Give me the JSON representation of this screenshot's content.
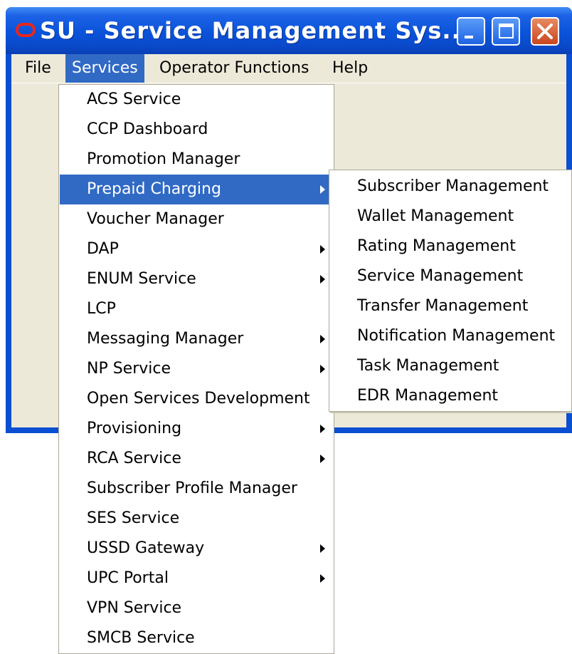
{
  "window": {
    "title": "SU - Service Management Sys...",
    "frame_color": "#0a4fd2",
    "menu_highlight_color": "#316ac5"
  },
  "menubar": [
    {
      "label": "File",
      "active": false
    },
    {
      "label": "Services",
      "active": true
    },
    {
      "label": "Operator Functions",
      "active": false
    },
    {
      "label": "Help",
      "active": false
    }
  ],
  "services_menu": {
    "items": [
      {
        "label": "ACS Service",
        "submenu": false
      },
      {
        "label": "CCP Dashboard",
        "submenu": false
      },
      {
        "label": "Promotion Manager",
        "submenu": false
      },
      {
        "label": "Prepaid Charging",
        "submenu": true,
        "highlighted": true
      },
      {
        "label": "Voucher Manager",
        "submenu": false
      },
      {
        "label": "DAP",
        "submenu": true
      },
      {
        "label": "ENUM Service",
        "submenu": true
      },
      {
        "label": "LCP",
        "submenu": false
      },
      {
        "label": "Messaging Manager",
        "submenu": true
      },
      {
        "label": "NP Service",
        "submenu": true
      },
      {
        "label": "Open Services Development",
        "submenu": false
      },
      {
        "label": "Provisioning",
        "submenu": true
      },
      {
        "label": "RCA Service",
        "submenu": true
      },
      {
        "label": "Subscriber Profile Manager",
        "submenu": false
      },
      {
        "label": "SES Service",
        "submenu": false
      },
      {
        "label": "USSD Gateway",
        "submenu": true
      },
      {
        "label": "UPC Portal",
        "submenu": true
      },
      {
        "label": "VPN Service",
        "submenu": false
      },
      {
        "label": "SMCB Service",
        "submenu": false
      }
    ]
  },
  "prepaid_charging_submenu": {
    "items": [
      "Subscriber Management",
      "Wallet Management",
      "Rating Management",
      "Service Management",
      "Transfer Management",
      "Notification Management",
      "Task Management",
      "EDR Management"
    ]
  }
}
